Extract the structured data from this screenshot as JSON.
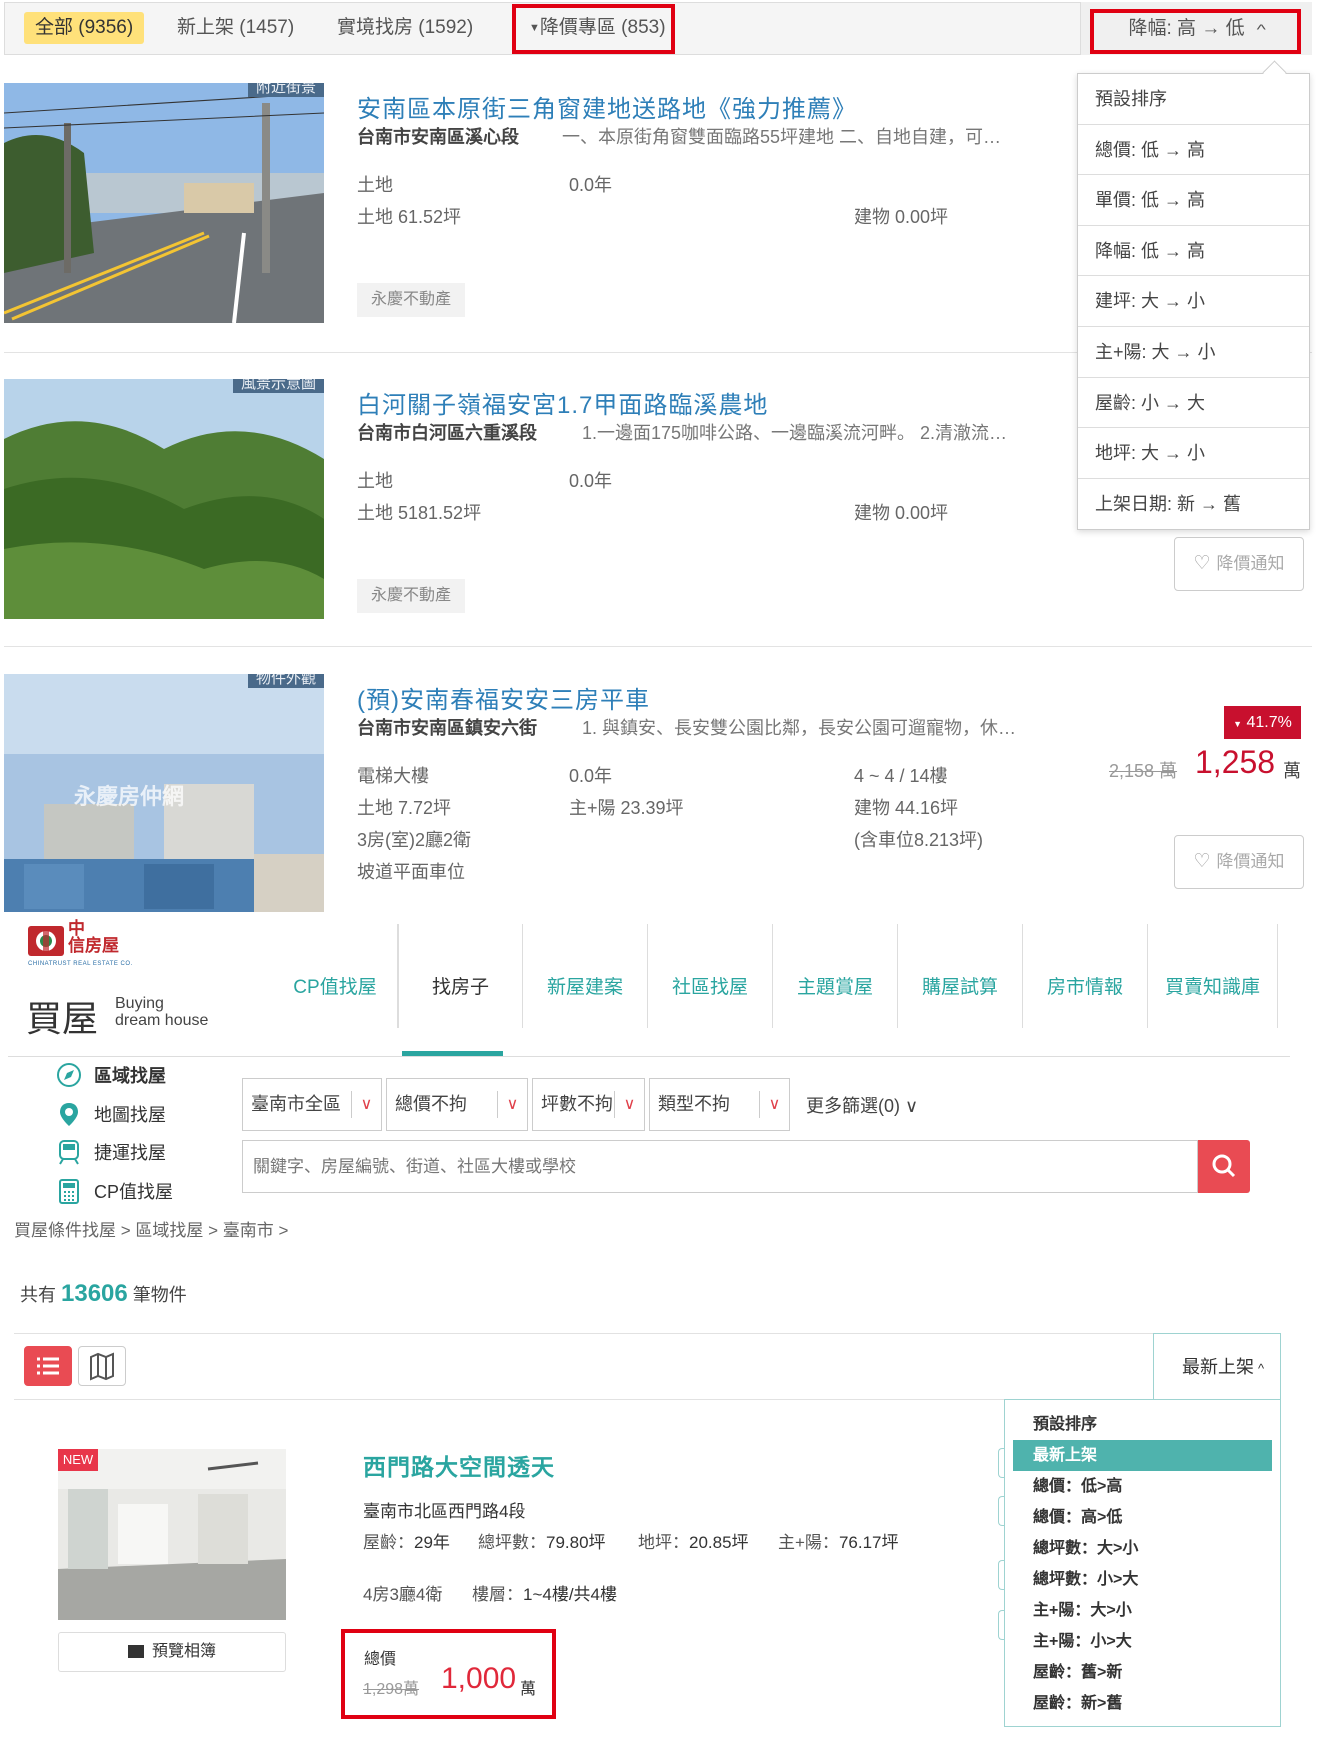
{
  "top": {
    "tabs": [
      {
        "label": "全部 (9356)"
      },
      {
        "label": "新上架 (1457)"
      },
      {
        "label": "實境找房 (1592)"
      },
      {
        "label": "降價專區 (853)"
      }
    ],
    "sort_label": "降幅: 高 → 低",
    "sort_menu": [
      "預設排序",
      "總價: 低 → 高",
      "單價: 低 → 高",
      "降幅: 低 → 高",
      "建坪: 大 → 小",
      "主+陽: 大 → 小",
      "屋齡: 小 → 大",
      "地坪: 大 → 小",
      "上架日期: 新 → 舊"
    ],
    "listings": [
      {
        "photo_caption": "附近街景",
        "title": "安南區本原街三角窗建地送路地《強力推薦》",
        "address": "台南市安南區溪心段",
        "desc": "一、本原街角窗雙面臨路55坪建地 二、自地自建，可…",
        "type": "土地",
        "age": "0.0年",
        "land": "土地 61.52坪",
        "building": "建物 0.00坪",
        "agent": "永慶不動產"
      },
      {
        "photo_caption": "風景示意圖",
        "title": "白河關子嶺福安宮1.7甲面路臨溪農地",
        "address": "台南市白河區六重溪段",
        "desc": "1.一邊面175咖啡公路、一邊臨溪流河畔。 2.清澈流…",
        "type": "土地",
        "age": "0.0年",
        "land": "土地 5181.52坪",
        "building": "建物 0.00坪",
        "agent": "永慶不動產",
        "notify": "降價通知"
      },
      {
        "photo_caption": "物件外觀",
        "photo_watermark": "永慶房仲網",
        "title": "(預)安南春福安安三房平車",
        "address": "台南市安南區鎮安六街",
        "desc": "1. 與鎮安、長安雙公園比鄰，長安公園可遛寵物，休…",
        "type": "電梯大樓",
        "age": "0.0年",
        "floor": "4 ~ 4 / 14樓",
        "land": "土地 7.72坪",
        "main": "主+陽 23.39坪",
        "building": "建物 44.16坪",
        "layout": "3房(室)2廳2衛",
        "parking_note": "(含車位8.213坪)",
        "parking": "坡道平面車位",
        "drop": "41.7%",
        "old_price": "2,158 萬",
        "new_price": "1,258",
        "unit": "萬",
        "notify": "降價通知"
      }
    ]
  },
  "bottom": {
    "logo": {
      "line1": "中",
      "line2": "信房屋",
      "sub": "CHINATRUST REAL ESTATE CO."
    },
    "section_title": "買屋",
    "section_en_1": "Buying",
    "section_en_2": "dream house",
    "nav": [
      "CP值找屋",
      "找房子",
      "新屋建案",
      "社區找屋",
      "主題賞屋",
      "購屋試算",
      "房市情報",
      "買賣知識庫"
    ],
    "side_links": [
      "區域找屋",
      "地圖找屋",
      "捷運找屋",
      "CP值找屋"
    ],
    "filters": [
      "臺南市全區",
      "總價不拘",
      "坪數不拘",
      "類型不拘"
    ],
    "more_filter": "更多篩選(0)",
    "search_placeholder": "關鍵字、房屋編號、街道、社區大樓或學校",
    "breadcrumb": "買屋條件找屋 > 區域找屋 > 臺南市 >",
    "count_prefix": "共有",
    "count": "13606",
    "count_suffix": "筆物件",
    "sort_label": "最新上架",
    "sort_menu": [
      "預設排序",
      "最新上架",
      "總價：低>高",
      "總價：高>低",
      "總坪數：大>小",
      "總坪數：小>大",
      "主+陽：大>小",
      "主+陽：小>大",
      "屋齡：舊>新",
      "屋齡：新>舊"
    ],
    "listing": {
      "new_tag": "NEW",
      "album": "預覽相簿",
      "title": "西門路大空間透天",
      "address": "臺南市北區西門路4段",
      "age_label": "屋齡：",
      "age": "29年",
      "total_label": "總坪數：",
      "total": "79.80坪",
      "land_label": "地坪：",
      "land": "20.85坪",
      "main_label": "主+陽：",
      "main": "76.17坪",
      "layout": "4房3廳4衛",
      "floor_label": "樓層：",
      "floor": "1~4樓/共4樓",
      "price_label": "總價",
      "old_price": "1,298萬",
      "new_price": "1,000",
      "unit": "萬"
    }
  }
}
